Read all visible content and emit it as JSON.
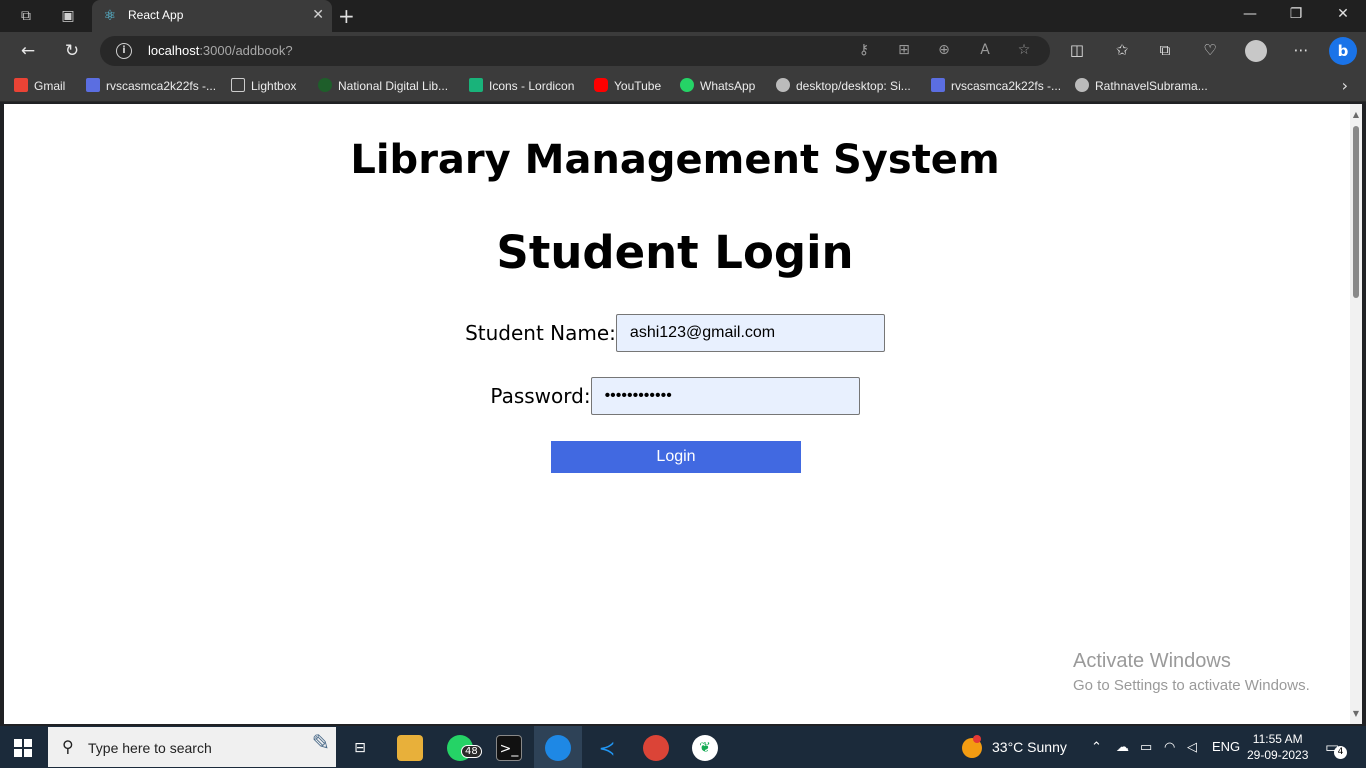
{
  "browser": {
    "tab_title": "React App",
    "address_host": "localhost",
    "address_path": ":3000/addbook?"
  },
  "bookmarks": [
    {
      "label": "Gmail",
      "color": "#ea4335"
    },
    {
      "label": "rvscasmca2k22fs -...",
      "color": "#5b6ee1"
    },
    {
      "label": "Lightbox",
      "color": "#cccccc"
    },
    {
      "label": "National Digital Lib...",
      "color": "#1e5e2a"
    },
    {
      "label": "Icons - Lordicon",
      "color": "#19b37a"
    },
    {
      "label": "YouTube",
      "color": "#ff0000"
    },
    {
      "label": "WhatsApp",
      "color": "#25d366"
    },
    {
      "label": "desktop/desktop: Si...",
      "color": "#bbbbbb"
    },
    {
      "label": "rvscasmca2k22fs -...",
      "color": "#5b6ee1"
    },
    {
      "label": "RathnavelSubrama...",
      "color": "#bbbbbb"
    }
  ],
  "page": {
    "app_title": "Library Management System",
    "heading": "Student Login",
    "name_label": "Student Name:",
    "name_value": "ashi123@gmail.com",
    "password_label": "Password:",
    "password_value": "••••••••••••",
    "login_label": "Login"
  },
  "activate": {
    "title": "Activate Windows",
    "subtitle": "Go to Settings to activate Windows."
  },
  "taskbar": {
    "search_placeholder": "Type here to search",
    "whatsapp_badge": "48",
    "weather": "33°C  Sunny",
    "language": "ENG",
    "time": "11:55 AM",
    "date": "29-09-2023",
    "notifications": "4"
  },
  "colors": {
    "accent": "#4169e1",
    "input_bg": "#e8f0fe"
  }
}
